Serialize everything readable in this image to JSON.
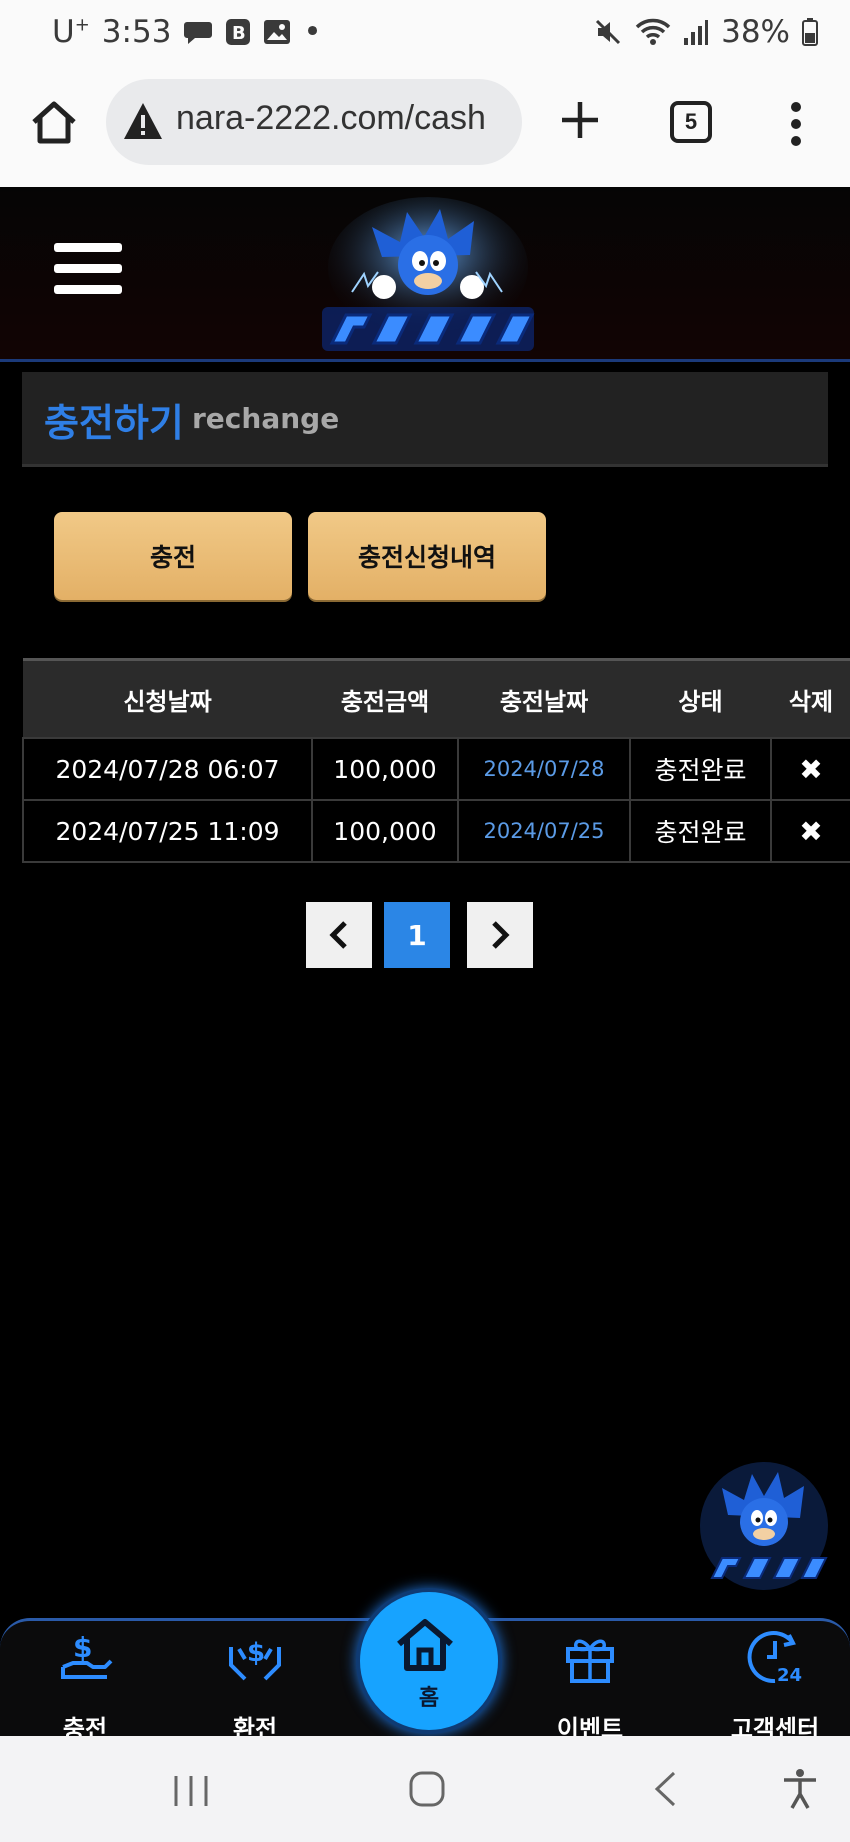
{
  "status_bar": {
    "carrier": "U",
    "carrier_sup": "+",
    "time": "3:53",
    "dot": "•",
    "battery": "38%"
  },
  "browser": {
    "url": "nara-2222.com/cash",
    "tab_count": "5"
  },
  "page": {
    "title": "충전하기",
    "subtitle": "rechange",
    "charge_button": "충전",
    "history_button": "충전신청내역"
  },
  "table": {
    "headers": [
      "신청날짜",
      "충전금액",
      "충전날짜",
      "상태",
      "삭제"
    ],
    "rows": [
      {
        "request_date": "2024/07/28 06:07",
        "amount": "100,000",
        "charge_date": "2024/07/28",
        "status": "충전완료",
        "delete": "✖"
      },
      {
        "request_date": "2024/07/25 11:09",
        "amount": "100,000",
        "charge_date": "2024/07/25",
        "status": "충전완료",
        "delete": "✖"
      }
    ]
  },
  "pagination": {
    "current": "1"
  },
  "bottom_nav": {
    "items": [
      "충전",
      "환전",
      "홈",
      "이벤트",
      "고객센터"
    ]
  },
  "icons": {
    "status": [
      "chat-icon",
      "b-icon",
      "gallery-icon",
      "mute-icon",
      "wifi-icon",
      "signal-icon",
      "battery-icon"
    ],
    "browser": [
      "home-icon",
      "warning-icon",
      "plus-icon",
      "tabs-icon",
      "more-icon"
    ],
    "nav": [
      "charge-icon",
      "exchange-icon",
      "home-icon",
      "gift-icon",
      "support-24-icon"
    ]
  },
  "colors": {
    "accent_blue": "#2f7fe6",
    "gold": "#e8b872",
    "nav_home": "#17a3ff"
  }
}
